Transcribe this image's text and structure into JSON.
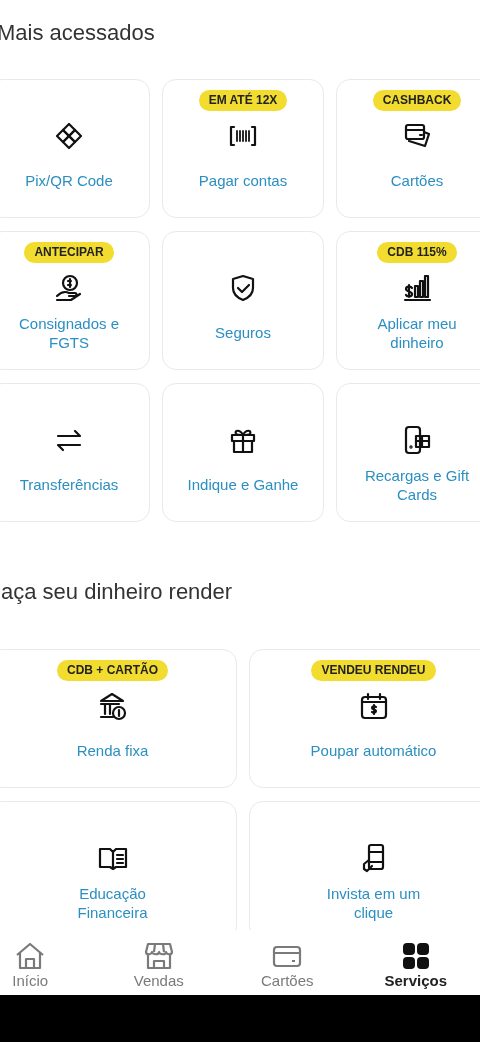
{
  "sections": [
    {
      "title": "Mais acessados",
      "items": [
        {
          "label": "Pix/QR Code"
        },
        {
          "label": "Pagar contas",
          "badge": "EM ATÉ 12X"
        },
        {
          "label": "Cartões",
          "badge": "CASHBACK"
        },
        {
          "label": "Consignados e FGTS",
          "badge": "ANTECIPAR"
        },
        {
          "label": "Seguros"
        },
        {
          "label": "Aplicar meu dinheiro",
          "badge": "CDB 115%"
        },
        {
          "label": "Transferências"
        },
        {
          "label": "Indique e Ganhe"
        },
        {
          "label": "Recargas e Gift Cards"
        }
      ]
    },
    {
      "title": "aça seu dinheiro render",
      "items": [
        {
          "label": "Renda fixa",
          "badge": "CDB + CARTÃO"
        },
        {
          "label": "Poupar automático",
          "badge": "VENDEU RENDEU"
        },
        {
          "label": "Educação Financeira"
        },
        {
          "label": "Invista em um clique"
        }
      ]
    }
  ],
  "bottom_nav": [
    {
      "label": "Início",
      "selected": false
    },
    {
      "label": "Vendas",
      "selected": false
    },
    {
      "label": "Cartões",
      "selected": false
    },
    {
      "label": "Serviços",
      "selected": true
    }
  ]
}
